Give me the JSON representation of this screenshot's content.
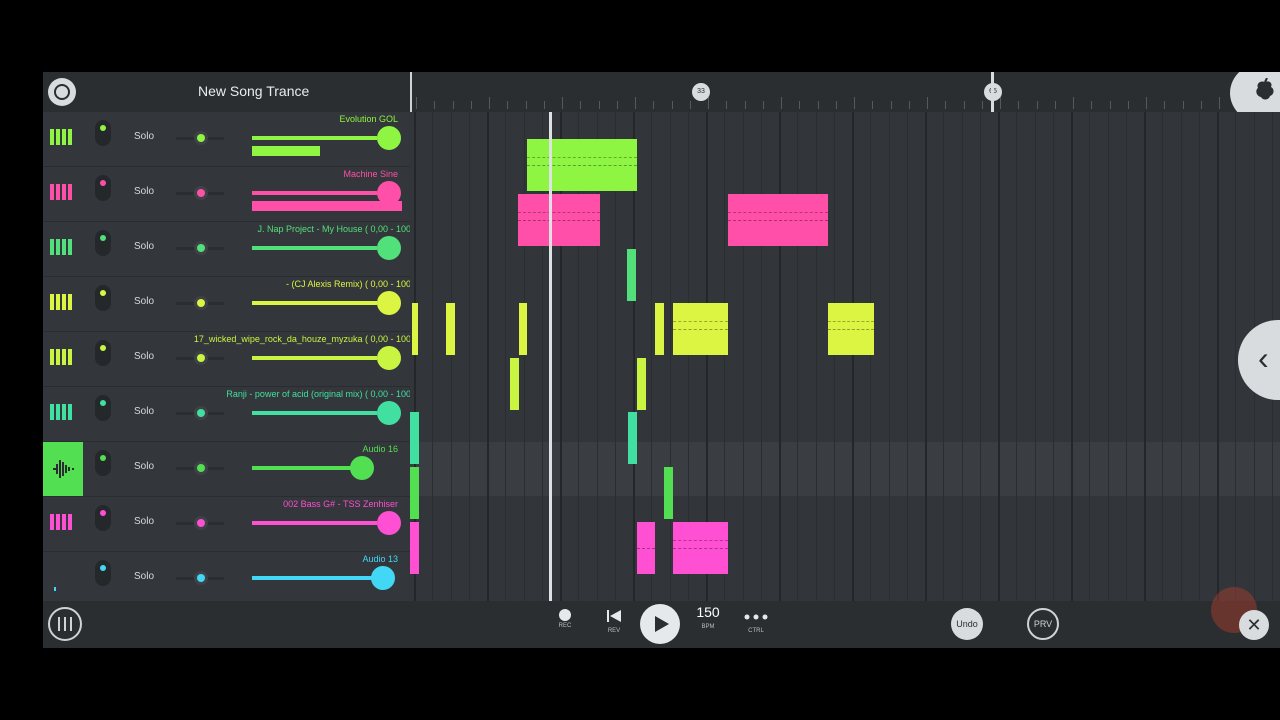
{
  "header": {
    "song_title": "New Song Trance",
    "timeline_markers": [
      "33",
      "65"
    ]
  },
  "tracks": [
    {
      "name": "Evolution GOL",
      "type": "instrument",
      "color": "#8ef542",
      "solo_label": "Solo",
      "volume": 0.92
    },
    {
      "name": "Machine Sine",
      "type": "instrument",
      "color": "#ff4fa8",
      "solo_label": "Solo",
      "volume": 0.92
    },
    {
      "name": "J. Nap Project - My House (     0,00 -      100)",
      "type": "instrument",
      "color": "#52e07a",
      "solo_label": "Solo",
      "volume": 0.92
    },
    {
      "name": "- (CJ Alexis Remix) (     0,00 -      100)",
      "type": "instrument",
      "color": "#dcf542",
      "solo_label": "Solo",
      "volume": 0.92
    },
    {
      "name": "17_wicked_wipe_rock_da_houze_myzuka (     0,00 -      100)",
      "type": "instrument",
      "color": "#c9f542",
      "solo_label": "Solo",
      "volume": 0.92
    },
    {
      "name": "Ranji - power of acid (original mix) (     0,00 -      100)",
      "type": "instrument",
      "color": "#42e0a0",
      "solo_label": "Solo",
      "volume": 0.92
    },
    {
      "name": "Audio 16",
      "type": "audio",
      "color": "#52e052",
      "solo_label": "Solo",
      "volume": 0.8
    },
    {
      "name": "002 Bass G# - TSS Zenhiser",
      "type": "instrument",
      "color": "#ff4fd2",
      "solo_label": "Solo",
      "volume": 0.92
    },
    {
      "name": "Audio 13",
      "type": "audio",
      "color": "#42d8f5",
      "solo_label": "Solo",
      "volume": 0.92
    }
  ],
  "transport": {
    "rec_label": "REC",
    "rev_label": "REV",
    "bpm_value": "150",
    "bpm_label": "BPM",
    "ctrl_label": "CTRL",
    "undo_label": "Undo",
    "prv_label": "PRV"
  },
  "icons": {
    "logo": "fl-logo-icon",
    "fruit": "fruit-icon",
    "collapse": "chevron-left-icon",
    "mixer": "mixer-icon",
    "record": "record-icon",
    "rewind": "skip-back-icon",
    "play": "play-icon",
    "more": "more-icon",
    "close": "close-icon"
  }
}
